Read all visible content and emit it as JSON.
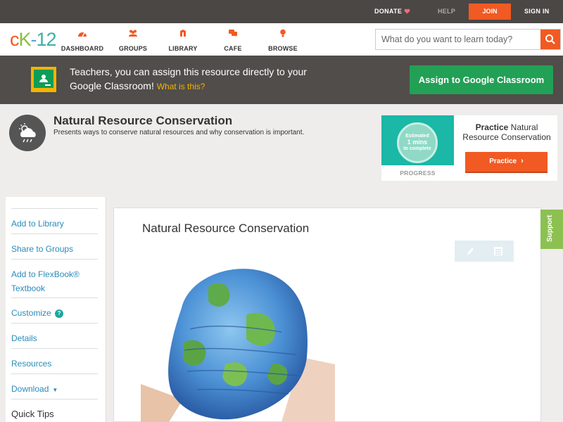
{
  "topbar": {
    "donate": "DONATE",
    "help": "HELP",
    "join": "JOIN",
    "signin": "SIGN IN"
  },
  "nav": {
    "logo": {
      "c": "c",
      "k": "K",
      "dash": "-",
      "num": "12"
    },
    "items": [
      {
        "label": "DASHBOARD",
        "icon": "dashboard-icon"
      },
      {
        "label": "GROUPS",
        "icon": "groups-icon"
      },
      {
        "label": "LIBRARY",
        "icon": "library-icon"
      },
      {
        "label": "CAFE",
        "icon": "cafe-icon"
      },
      {
        "label": "BROWSE",
        "icon": "browse-icon"
      }
    ],
    "search_placeholder": "What do you want to learn today?"
  },
  "banner": {
    "text": "Teachers, you can assign this resource directly to your Google Classroom!",
    "what_link": "What is this?",
    "assign_label": "Assign to Google Classroom"
  },
  "concept": {
    "title": "Natural Resource Conservation",
    "subtitle": "Presents ways to conserve natural resources and why conservation is important."
  },
  "practice": {
    "estimated_line1": "Estimated",
    "estimated_line2": "1 mins",
    "estimated_line3": "to complete",
    "progress_label": "PROGRESS",
    "title_bold": "Practice",
    "title_rest": "Natural Resource Conservation",
    "button_label": "Practice"
  },
  "sidebar": {
    "items": [
      {
        "label": "Add to Library"
      },
      {
        "label": "Share to Groups"
      },
      {
        "label": "Add to FlexBook® Textbook"
      },
      {
        "label": "Customize"
      },
      {
        "label": "Details"
      },
      {
        "label": "Resources"
      },
      {
        "label": "Download"
      },
      {
        "label": "Quick Tips"
      }
    ],
    "help_glyph": "?",
    "caret": "▼"
  },
  "main": {
    "title": "Natural Resource Conservation"
  },
  "support": "Support",
  "colors": {
    "brand_orange": "#f15a22",
    "google_green": "#22a056",
    "link_blue": "#2a8bb9",
    "support_green": "#8cc152"
  }
}
